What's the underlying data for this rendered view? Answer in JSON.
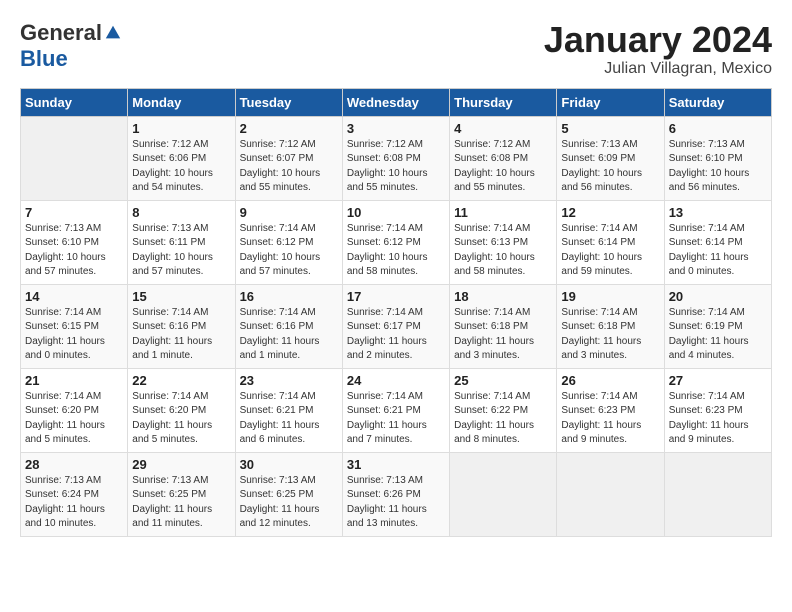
{
  "header": {
    "logo_general": "General",
    "logo_blue": "Blue",
    "month_title": "January 2024",
    "subtitle": "Julian Villagran, Mexico"
  },
  "weekdays": [
    "Sunday",
    "Monday",
    "Tuesday",
    "Wednesday",
    "Thursday",
    "Friday",
    "Saturday"
  ],
  "weeks": [
    [
      {
        "day": "",
        "info": ""
      },
      {
        "day": "1",
        "info": "Sunrise: 7:12 AM\nSunset: 6:06 PM\nDaylight: 10 hours\nand 54 minutes."
      },
      {
        "day": "2",
        "info": "Sunrise: 7:12 AM\nSunset: 6:07 PM\nDaylight: 10 hours\nand 55 minutes."
      },
      {
        "day": "3",
        "info": "Sunrise: 7:12 AM\nSunset: 6:08 PM\nDaylight: 10 hours\nand 55 minutes."
      },
      {
        "day": "4",
        "info": "Sunrise: 7:12 AM\nSunset: 6:08 PM\nDaylight: 10 hours\nand 55 minutes."
      },
      {
        "day": "5",
        "info": "Sunrise: 7:13 AM\nSunset: 6:09 PM\nDaylight: 10 hours\nand 56 minutes."
      },
      {
        "day": "6",
        "info": "Sunrise: 7:13 AM\nSunset: 6:10 PM\nDaylight: 10 hours\nand 56 minutes."
      }
    ],
    [
      {
        "day": "7",
        "info": "Sunrise: 7:13 AM\nSunset: 6:10 PM\nDaylight: 10 hours\nand 57 minutes."
      },
      {
        "day": "8",
        "info": "Sunrise: 7:13 AM\nSunset: 6:11 PM\nDaylight: 10 hours\nand 57 minutes."
      },
      {
        "day": "9",
        "info": "Sunrise: 7:14 AM\nSunset: 6:12 PM\nDaylight: 10 hours\nand 57 minutes."
      },
      {
        "day": "10",
        "info": "Sunrise: 7:14 AM\nSunset: 6:12 PM\nDaylight: 10 hours\nand 58 minutes."
      },
      {
        "day": "11",
        "info": "Sunrise: 7:14 AM\nSunset: 6:13 PM\nDaylight: 10 hours\nand 58 minutes."
      },
      {
        "day": "12",
        "info": "Sunrise: 7:14 AM\nSunset: 6:14 PM\nDaylight: 10 hours\nand 59 minutes."
      },
      {
        "day": "13",
        "info": "Sunrise: 7:14 AM\nSunset: 6:14 PM\nDaylight: 11 hours\nand 0 minutes."
      }
    ],
    [
      {
        "day": "14",
        "info": "Sunrise: 7:14 AM\nSunset: 6:15 PM\nDaylight: 11 hours\nand 0 minutes."
      },
      {
        "day": "15",
        "info": "Sunrise: 7:14 AM\nSunset: 6:16 PM\nDaylight: 11 hours\nand 1 minute."
      },
      {
        "day": "16",
        "info": "Sunrise: 7:14 AM\nSunset: 6:16 PM\nDaylight: 11 hours\nand 1 minute."
      },
      {
        "day": "17",
        "info": "Sunrise: 7:14 AM\nSunset: 6:17 PM\nDaylight: 11 hours\nand 2 minutes."
      },
      {
        "day": "18",
        "info": "Sunrise: 7:14 AM\nSunset: 6:18 PM\nDaylight: 11 hours\nand 3 minutes."
      },
      {
        "day": "19",
        "info": "Sunrise: 7:14 AM\nSunset: 6:18 PM\nDaylight: 11 hours\nand 3 minutes."
      },
      {
        "day": "20",
        "info": "Sunrise: 7:14 AM\nSunset: 6:19 PM\nDaylight: 11 hours\nand 4 minutes."
      }
    ],
    [
      {
        "day": "21",
        "info": "Sunrise: 7:14 AM\nSunset: 6:20 PM\nDaylight: 11 hours\nand 5 minutes."
      },
      {
        "day": "22",
        "info": "Sunrise: 7:14 AM\nSunset: 6:20 PM\nDaylight: 11 hours\nand 5 minutes."
      },
      {
        "day": "23",
        "info": "Sunrise: 7:14 AM\nSunset: 6:21 PM\nDaylight: 11 hours\nand 6 minutes."
      },
      {
        "day": "24",
        "info": "Sunrise: 7:14 AM\nSunset: 6:21 PM\nDaylight: 11 hours\nand 7 minutes."
      },
      {
        "day": "25",
        "info": "Sunrise: 7:14 AM\nSunset: 6:22 PM\nDaylight: 11 hours\nand 8 minutes."
      },
      {
        "day": "26",
        "info": "Sunrise: 7:14 AM\nSunset: 6:23 PM\nDaylight: 11 hours\nand 9 minutes."
      },
      {
        "day": "27",
        "info": "Sunrise: 7:14 AM\nSunset: 6:23 PM\nDaylight: 11 hours\nand 9 minutes."
      }
    ],
    [
      {
        "day": "28",
        "info": "Sunrise: 7:13 AM\nSunset: 6:24 PM\nDaylight: 11 hours\nand 10 minutes."
      },
      {
        "day": "29",
        "info": "Sunrise: 7:13 AM\nSunset: 6:25 PM\nDaylight: 11 hours\nand 11 minutes."
      },
      {
        "day": "30",
        "info": "Sunrise: 7:13 AM\nSunset: 6:25 PM\nDaylight: 11 hours\nand 12 minutes."
      },
      {
        "day": "31",
        "info": "Sunrise: 7:13 AM\nSunset: 6:26 PM\nDaylight: 11 hours\nand 13 minutes."
      },
      {
        "day": "",
        "info": ""
      },
      {
        "day": "",
        "info": ""
      },
      {
        "day": "",
        "info": ""
      }
    ]
  ]
}
